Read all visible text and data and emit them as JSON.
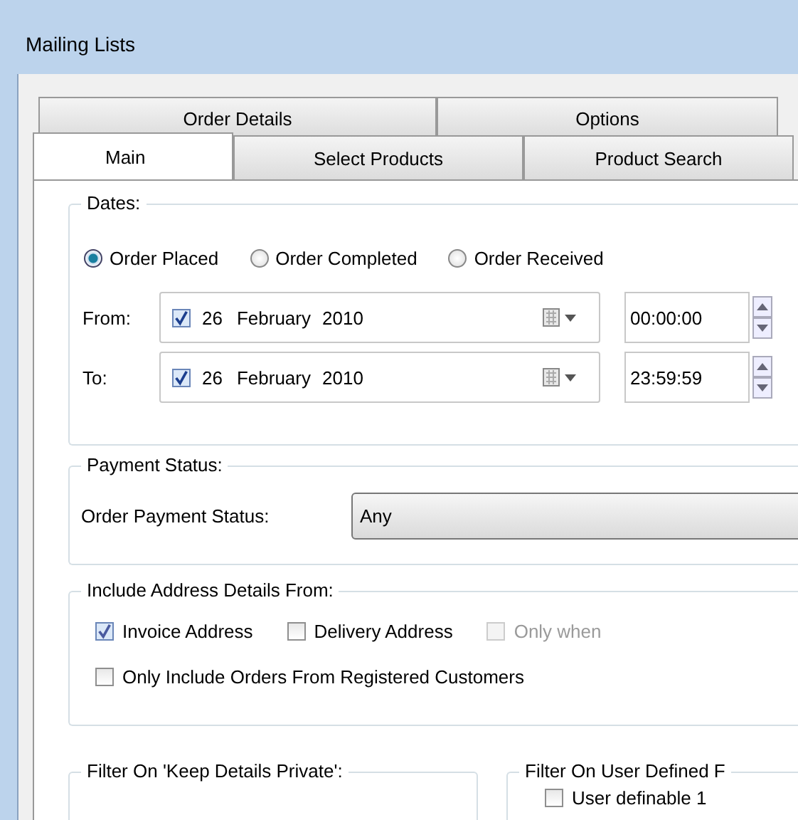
{
  "window": {
    "title": "Mailing Lists"
  },
  "tab_rows": [
    [
      {
        "label": "Order Details",
        "selected": false
      },
      {
        "label": "Options",
        "selected": false
      }
    ],
    [
      {
        "label": "Main",
        "selected": true
      },
      {
        "label": "Select Products",
        "selected": false
      },
      {
        "label": "Product Search",
        "selected": false
      }
    ]
  ],
  "dates": {
    "title": "Dates:",
    "options": [
      {
        "label": "Order Placed",
        "selected": true
      },
      {
        "label": "Order Completed",
        "selected": false
      },
      {
        "label": "Order Received",
        "selected": false
      }
    ],
    "ranges": [
      {
        "label": "From:",
        "checked": true,
        "day": "26",
        "month": "February",
        "year": "2010",
        "time": "00:00:00"
      },
      {
        "label": "To:",
        "checked": true,
        "day": "26",
        "month": "February",
        "year": "2010",
        "time": "23:59:59"
      }
    ]
  },
  "payment": {
    "title": "Payment Status:",
    "label": "Order Payment Status:",
    "value": "Any"
  },
  "address": {
    "title": "Include Address Details From:",
    "checkboxes": [
      {
        "label": "Invoice Address",
        "checked": true,
        "disabled": false
      },
      {
        "label": "Delivery Address",
        "checked": false,
        "disabled": false
      },
      {
        "label": "Only when",
        "checked": false,
        "disabled": true
      }
    ],
    "registered": {
      "label": "Only Include Orders From Registered Customers",
      "checked": false
    }
  },
  "filters": [
    {
      "title": "Filter On 'Keep Details Private':"
    },
    {
      "title": "Filter On User Defined F",
      "checkboxes": [
        {
          "label": "User definable 1",
          "checked": false
        }
      ]
    }
  ]
}
